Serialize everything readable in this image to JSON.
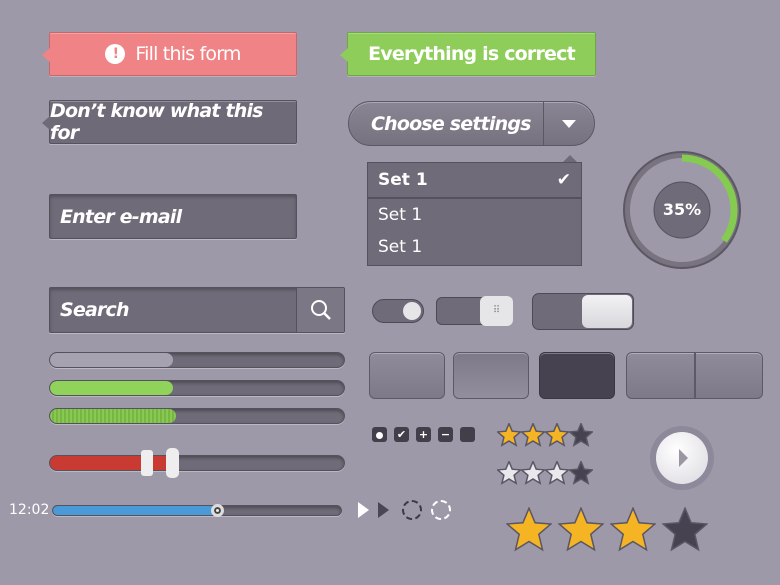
{
  "tooltips": {
    "error": "Fill this form",
    "success": "Everything is correct",
    "info": "Don’t know what this for"
  },
  "select": {
    "label": "Choose settings",
    "options": [
      "Set 1",
      "Set 1",
      "Set 1"
    ],
    "selected_index": 0
  },
  "email": {
    "placeholder": "Enter e-mail"
  },
  "search": {
    "placeholder": "Search"
  },
  "donut": {
    "value": 35,
    "label": "35%"
  },
  "progress": [
    42,
    42,
    43
  ],
  "range_slider": {
    "low": 32,
    "high": 41
  },
  "media": {
    "time": "12:02",
    "position": 57
  },
  "toggles": [
    "on",
    "on",
    "on"
  ],
  "ratings": {
    "small_gold": 3,
    "small_white": 3,
    "big": 3,
    "max": 4
  },
  "colors": {
    "background": "#9e99a9",
    "error": "#f08385",
    "success": "#8fcd5a",
    "accent_green": "#8fcd5a",
    "red": "#c83a32",
    "blue": "#4a9ad8",
    "star": "#f4b423"
  }
}
